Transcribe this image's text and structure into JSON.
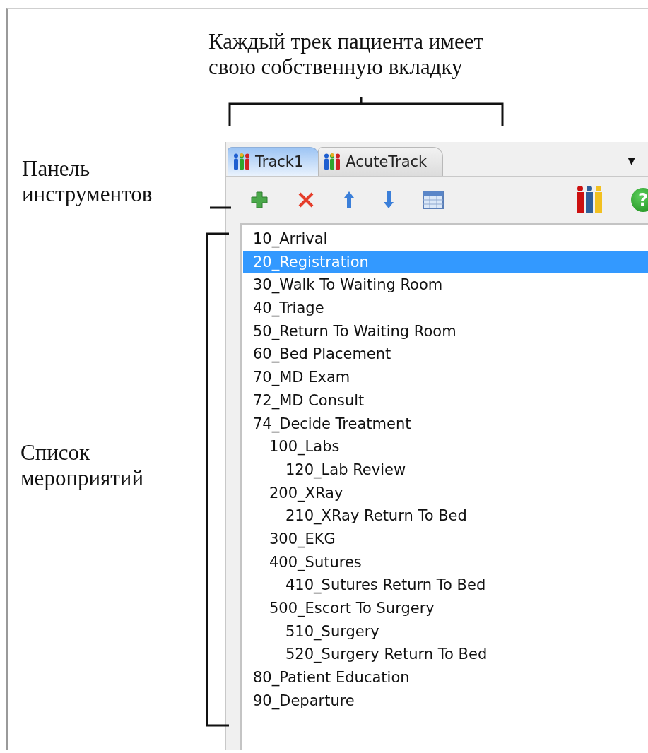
{
  "annotations": [
    {
      "kind": "tabs",
      "text": "Каждый трек пациента имеет\nсвою собственную вкладку"
    },
    {
      "kind": "toolbar",
      "text": "Панель\nинструментов"
    },
    {
      "kind": "list",
      "text": "Список\nмероприятий"
    }
  ],
  "tabs": [
    {
      "label": "Track1",
      "selected": true
    },
    {
      "label": "AcuteTrack",
      "selected": false
    }
  ],
  "tab_menu_glyph": "▼",
  "toolbar": [
    {
      "kind": "add"
    },
    {
      "kind": "delete"
    },
    {
      "kind": "up"
    },
    {
      "kind": "down"
    },
    {
      "kind": "grid"
    },
    {
      "kind": "gap"
    },
    {
      "kind": "people"
    },
    {
      "kind": "help",
      "glyph": "?"
    }
  ],
  "activities": [
    {
      "label": "10_Arrival",
      "selected": false
    },
    {
      "label": "20_Registration",
      "selected": true
    },
    {
      "label": "30_Walk To Waiting Room",
      "selected": false
    },
    {
      "label": "40_Triage",
      "selected": false
    },
    {
      "label": "50_Return To Waiting Room",
      "selected": false
    },
    {
      "label": "60_Bed Placement",
      "selected": false
    },
    {
      "label": "70_MD Exam",
      "selected": false
    },
    {
      "label": "72_MD Consult",
      "selected": false
    },
    {
      "label": "74_Decide Treatment",
      "selected": false,
      "children": [
        {
          "label": "100_Labs",
          "selected": false,
          "children": [
            {
              "label": "120_Lab Review",
              "selected": false
            }
          ]
        },
        {
          "label": "200_XRay",
          "selected": false,
          "children": [
            {
              "label": "210_XRay Return To Bed",
              "selected": false
            }
          ]
        },
        {
          "label": "300_EKG",
          "selected": false
        },
        {
          "label": "400_Sutures",
          "selected": false,
          "children": [
            {
              "label": "410_Sutures Return To Bed",
              "selected": false
            }
          ]
        },
        {
          "label": "500_Escort To Surgery",
          "selected": false,
          "children": [
            {
              "label": "510_Surgery",
              "selected": false
            },
            {
              "label": "520_Surgery Return To Bed",
              "selected": false
            }
          ]
        }
      ]
    },
    {
      "label": "80_Patient Education",
      "selected": false
    },
    {
      "label": "90_Departure",
      "selected": false
    }
  ]
}
